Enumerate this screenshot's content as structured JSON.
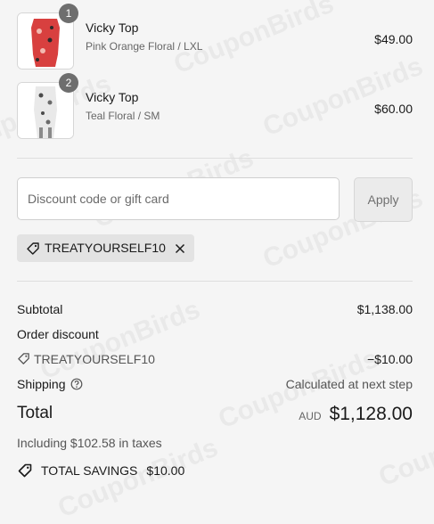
{
  "watermark": "CouponBirds",
  "items": [
    {
      "quantity": "1",
      "name": "Vicky Top",
      "variant": "Pink Orange Floral / LXL",
      "price": "$49.00",
      "image_color": "#d8403f"
    },
    {
      "quantity": "2",
      "name": "Vicky Top",
      "variant": "Teal Floral / SM",
      "price": "$60.00",
      "image_color": "#e9e9e9"
    }
  ],
  "discount": {
    "placeholder": "Discount code or gift card",
    "value": "",
    "apply_label": "Apply",
    "applied_code": "TREATYOURSELF10"
  },
  "summary": {
    "subtotal_label": "Subtotal",
    "subtotal_value": "$1,138.00",
    "order_discount_label": "Order discount",
    "discount_code": "TREATYOURSELF10",
    "discount_value": "−$10.00",
    "shipping_label": "Shipping",
    "shipping_value": "Calculated at next step",
    "total_label": "Total",
    "currency": "AUD",
    "total_value": "$1,128.00",
    "taxes_note": "Including $102.58 in taxes",
    "savings_label": "TOTAL SAVINGS",
    "savings_value": "$10.00"
  }
}
